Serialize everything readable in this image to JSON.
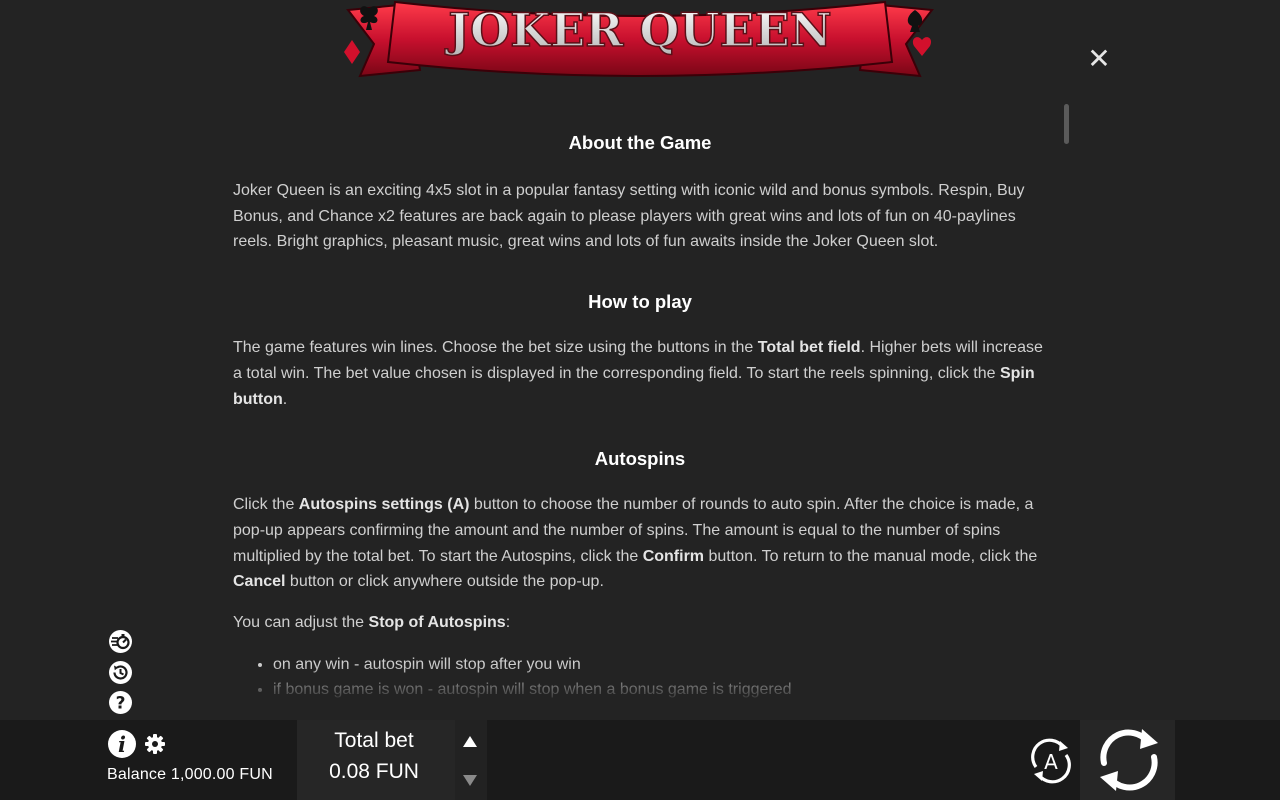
{
  "logo": {
    "text": "JOKER QUEEN"
  },
  "about": {
    "heading": "About the Game",
    "text": "Joker Queen is an exciting 4x5 slot in a popular fantasy setting with iconic wild and bonus symbols. Respin, Buy Bonus, and Chance x2 features are back again to please players with great wins and lots of fun on 40-paylines reels. Bright graphics, pleasant music, great wins and lots of fun awaits inside the Joker Queen slot."
  },
  "how_to_play": {
    "heading": "How to play",
    "t1": "The game features win lines. Choose the bet size using the buttons in the ",
    "b1": "Total bet field",
    "t2": ". Higher bets will increase a total win. The bet value chosen is displayed in the corresponding field. To start the reels spinning, click the ",
    "b2": "Spin button",
    "t3": "."
  },
  "autospins": {
    "heading": "Autospins",
    "p1_t1": "Click the ",
    "p1_b1": "Autospins settings (A)",
    "p1_t2": " button to choose the number of rounds to auto spin. After the choice is made, a pop-up appears confirming the amount and the number of spins. The amount is equal to the number of spins multiplied by the total bet. To start the Autospins, click the ",
    "p1_b2": "Confirm",
    "p1_t3": " button. To return to the manual mode, click the ",
    "p1_b3": "Cancel",
    "p1_t4": " button or click anywhere outside the pop-up.",
    "p2_t1": "You can adjust the ",
    "p2_b1": "Stop of Autospins",
    "p2_t2": ":",
    "items": [
      "on any win - autospin will stop after you win",
      "if bonus game is won - autospin will stop when a bonus game is triggered"
    ]
  },
  "bottom_bar": {
    "balance_label": "Balance 1,000.00 FUN",
    "total_bet_label": "Total bet",
    "total_bet_value": "0.08 FUN",
    "autospin_letter": "A"
  },
  "icons": {
    "close": "close-icon",
    "turbo": "turbo-icon",
    "history": "history-icon",
    "help": "help-icon",
    "info": "info-icon",
    "settings": "gear-icon",
    "bet_up": "triangle-up-icon",
    "bet_down": "triangle-down-icon",
    "autospin": "autospin-icon",
    "spin": "spin-icon"
  },
  "colors": {
    "background": "#232323",
    "bottom_bar": "#1a1a1a",
    "ribbon_red": "#c8102e",
    "text": "#cfcfcf",
    "heading": "#ffffff"
  }
}
